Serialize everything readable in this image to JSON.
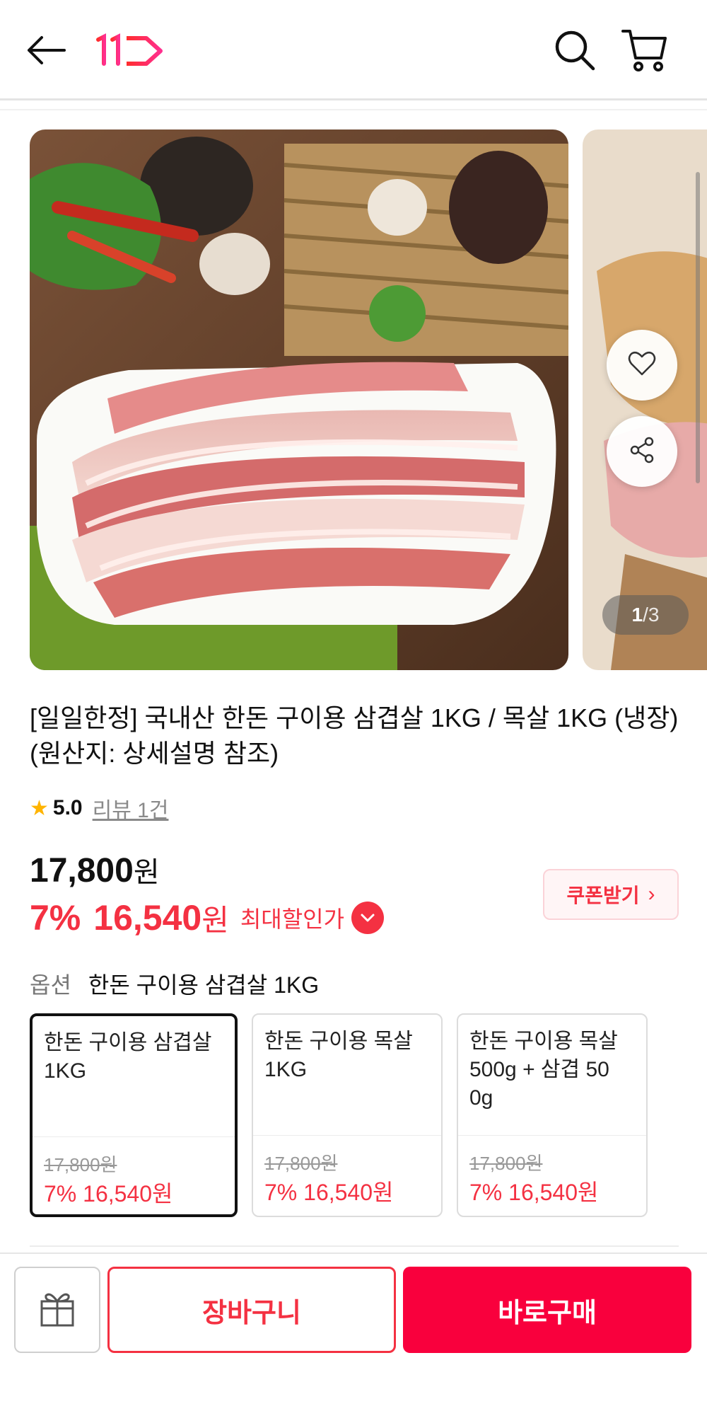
{
  "header": {
    "back_icon": "arrow-left-icon",
    "logo_text": "11",
    "search_icon": "search-icon",
    "cart_icon": "cart-icon"
  },
  "gallery": {
    "current": "1",
    "separator": "/",
    "total": "3",
    "wish_icon": "heart-icon",
    "share_icon": "share-icon"
  },
  "product": {
    "title": "[일일한정] 국내산 한돈 구이용 삼겹살 1KG / 목살 1KG (냉장) (원산지: 상세설명 참조)",
    "rating": "5.0",
    "reviews": "리뷰 1건",
    "original_price": "17,800",
    "won": "원",
    "discount_pct": "7%",
    "sale_price": "16,540",
    "max_discount_label": "최대할인가",
    "coupon_label": "쿠폰받기",
    "coupon_arrow": "›"
  },
  "options": {
    "label": "옵션",
    "selected": "한돈 구이용 삼겹살 1KG",
    "items": [
      {
        "name": "한돈 구이용 삼겹살\n 1KG",
        "original": "17,800원",
        "sale": "7% 16,540원"
      },
      {
        "name": "한돈 구이용 목살\n1KG",
        "original": "17,800원",
        "sale": "7% 16,540원"
      },
      {
        "name": "한돈 구이용 목살\n500g + 삼겹 50\n0g",
        "original": "17,800원",
        "sale": "7% 16,540원"
      }
    ]
  },
  "bottom_bar": {
    "gift_icon": "gift-icon",
    "cart_label": "장바구니",
    "buy_label": "바로구매"
  },
  "colors": {
    "accent": "#f43142",
    "buy_button": "#f9003d",
    "star": "#ffb400"
  }
}
